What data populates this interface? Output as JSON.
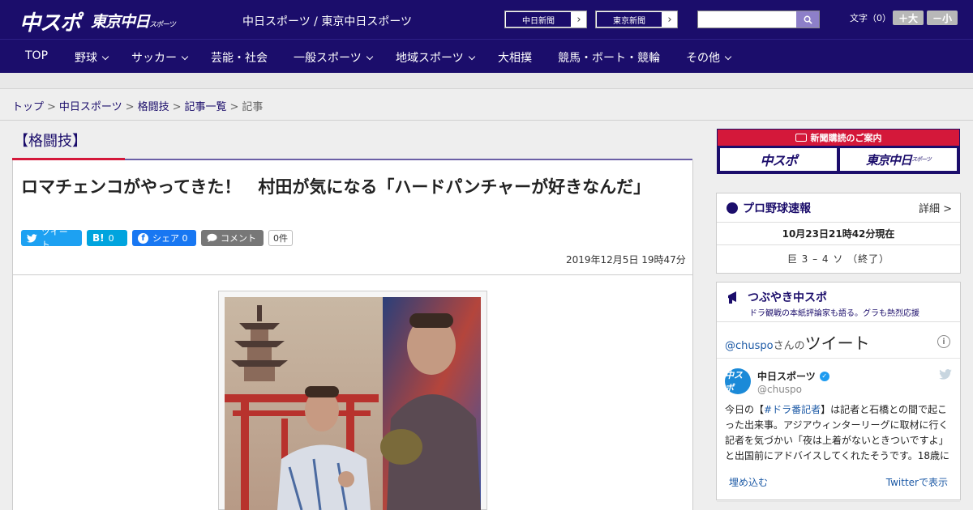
{
  "header": {
    "logo_chuspo": "中スポ",
    "logo_tokyo": "東京中日",
    "logo_tokyo_sub": "スポーツ",
    "site_title": "中日スポーツ / 東京中日スポーツ",
    "links": [
      "中日新聞",
      "東京新聞"
    ],
    "search_placeholder": "",
    "fontsize_label": "文字（0）",
    "fontsize_up": "＋大",
    "fontsize_down": "－小"
  },
  "nav": {
    "items": [
      "TOP",
      "野球",
      "サッカー",
      "芸能・社会",
      "一般スポーツ",
      "地域スポーツ",
      "大相撲",
      "競馬・ボート・競輪",
      "その他"
    ]
  },
  "breadcrumb": [
    "トップ",
    "中日スポーツ",
    "格闘技",
    "記事一覧",
    "記事"
  ],
  "article": {
    "category": "【格闘技】",
    "headline": "ロマチェンコがやってきた！　村田が気になる「ハードパンチャーが好きなんだ」",
    "share": {
      "tweet": "ツイート",
      "hatena_count": "0",
      "facebook": "シェア",
      "facebook_count": "0",
      "comment": "コメント",
      "comment_count": "0件"
    },
    "date": "2019年12月5日 19時47分"
  },
  "sidebar": {
    "subscribe_title": "新聞購読のご案内",
    "subscribe_logos": [
      "中スポ",
      "東京中日"
    ],
    "subscribe_logo_sub": "スポーツ",
    "baseball": {
      "title": "プロ野球速報",
      "detail": "詳細 >",
      "time": "10月23日21時42分現在",
      "score": "巨 3 – 4 ソ （終了）"
    },
    "twitter": {
      "title": "つぶやき中スポ",
      "subtitle": "ドラ観戦の本紙評論家も語る。グラも熱烈応援",
      "head_handle": "@chuspo",
      "head_san": "さんの",
      "head_big": "ツイート",
      "avatar_text": "中スポ",
      "name": "中日スポーツ",
      "handle": "@chuspo",
      "text_before": "今日の【",
      "tag": "#ドラ番記者",
      "text_after": "】は記者と石橋との間で起こった出来事。アジアウィンターリーグに取材に行く記者を気づかい「夜は上着がないときついですよ」と出国前にアドバイスしてくれたそうです。18歳に",
      "embed": "埋め込む",
      "view": "Twitterで表示"
    }
  },
  "colors": {
    "brand": "#1b0d6b",
    "accent": "#d4183a",
    "twitter": "#1da1f2",
    "hatena": "#00a4de",
    "facebook": "#1877f2",
    "comment": "#777777"
  }
}
